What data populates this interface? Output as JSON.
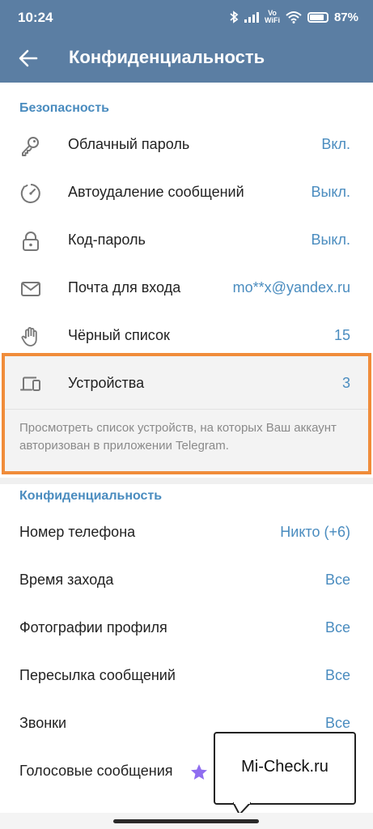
{
  "status_bar": {
    "time": "10:24",
    "vowifi_top": "Vo",
    "vowifi_bottom": "WiFi",
    "battery": "87%",
    "battery_level": 0.87
  },
  "app_bar": {
    "title": "Конфиденциальность",
    "back_icon": "arrow-left-icon",
    "color": "#5b7ea3"
  },
  "security": {
    "header": "Безопасность",
    "items": [
      {
        "icon": "key-icon",
        "label": "Облачный пароль",
        "value": "Вкл."
      },
      {
        "icon": "timer-icon",
        "label": "Автоудаление сообщений",
        "value": "Выкл."
      },
      {
        "icon": "lock-icon",
        "label": "Код-пароль",
        "value": "Выкл."
      },
      {
        "icon": "mail-icon",
        "label": "Почта для входа",
        "value": "mo**x@yandex.ru"
      },
      {
        "icon": "hand-icon",
        "label": "Чёрный список",
        "value": "15"
      },
      {
        "icon": "devices-icon",
        "label": "Устройства",
        "value": "3"
      }
    ],
    "devices_description": "Просмотреть список устройств, на которых Ваш аккаунт авторизован в приложении Telegram."
  },
  "privacy": {
    "header": "Конфиденциальность",
    "items": [
      {
        "label": "Номер телефона",
        "value": "Никто (+6)"
      },
      {
        "label": "Время захода",
        "value": "Все"
      },
      {
        "label": "Фотографии профиля",
        "value": "Все"
      },
      {
        "label": "Пересылка сообщений",
        "value": "Все"
      },
      {
        "label": "Звонки",
        "value": "Все"
      },
      {
        "label": "Голосовые сообщения",
        "icon": "premium-star-icon"
      }
    ]
  },
  "watermark": {
    "text": "Mi-Check.ru"
  },
  "colors": {
    "accent": "#4a8cbf",
    "highlight": "#f08c3a",
    "premium_star": "#8f6df0"
  }
}
